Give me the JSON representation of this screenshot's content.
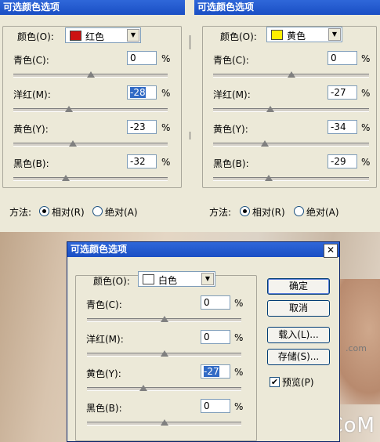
{
  "dialog_title": "可选颜色选项",
  "colors_label": "颜色(O):",
  "labels": {
    "cyan": "青色(C):",
    "magenta": "洋红(M):",
    "yellow": "黄色(Y):",
    "black": "黑色(B):"
  },
  "percent_sign": "%",
  "method_label": "方法:",
  "method_relative": "相对(R)",
  "method_absolute": "绝对(A)",
  "panels": [
    {
      "color_name": "红色",
      "swatch": "#cc1111",
      "cyan": "0",
      "magenta": "-28",
      "yellow": "-23",
      "black": "-32",
      "selected_method": "relative"
    },
    {
      "color_name": "黄色",
      "swatch": "#ffee00",
      "cyan": "0",
      "magenta": "-27",
      "yellow": "-34",
      "black": "-29",
      "selected_method": "relative"
    },
    {
      "color_name": "白色",
      "swatch": "#ffffff",
      "cyan": "0",
      "magenta": "0",
      "yellow": "-27",
      "black": "0"
    }
  ],
  "buttons": {
    "ok": "确定",
    "cancel": "取消",
    "load": "载入(L)...",
    "save": "存储(S)..."
  },
  "preview_label": "预览(P)",
  "preview_checked": true,
  "watermark": "UiBQ.CoM",
  "small_watermark": ".com"
}
